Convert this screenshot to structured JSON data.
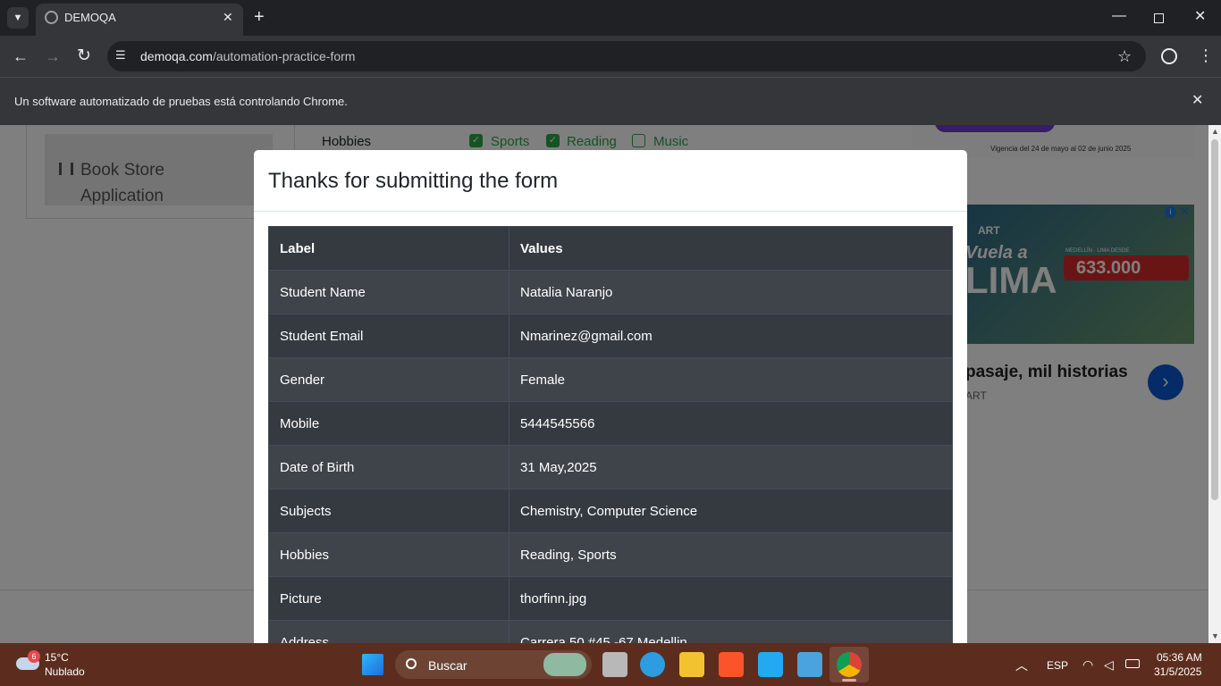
{
  "browser": {
    "tab_title": "DEMOQA",
    "url_host": "demoqa.com",
    "url_path": "/automation-practice-form",
    "automation_notice": "Un software automatizado de pruebas está controlando Chrome."
  },
  "page": {
    "sidebar_item": "Book Store Application",
    "hobbies_label": "Hobbies",
    "hobbies": [
      "Sports",
      "Reading",
      "Music"
    ],
    "ad_top_text": "Vigencia del 24 de mayo al 02 de junio 2025",
    "ad_title": "pasaje, mil historias",
    "ad_brand": "ART",
    "ad_headline": "Vuela a",
    "ad_city": "LIMA",
    "ad_price": "633.000",
    "ad_route": "MEDELLÍN · LIMA DESDE"
  },
  "modal": {
    "title": "Thanks for submitting the form",
    "headers": [
      "Label",
      "Values"
    ],
    "rows": [
      [
        "Student Name",
        "Natalia Naranjo"
      ],
      [
        "Student Email",
        "Nmarinez@gmail.com"
      ],
      [
        "Gender",
        "Female"
      ],
      [
        "Mobile",
        "5444545566"
      ],
      [
        "Date of Birth",
        "31 May,2025"
      ],
      [
        "Subjects",
        "Chemistry, Computer Science"
      ],
      [
        "Hobbies",
        "Reading, Sports"
      ],
      [
        "Picture",
        "thorfinn.jpg"
      ],
      [
        "Address",
        "Carrera 50 #45 -67 Medellin"
      ]
    ]
  },
  "taskbar": {
    "weather_temp": "15°C",
    "weather_desc": "Nublado",
    "weather_badge": "6",
    "search_placeholder": "Buscar",
    "lang": "ESP",
    "time": "05:36 AM",
    "date": "31/5/2025"
  }
}
